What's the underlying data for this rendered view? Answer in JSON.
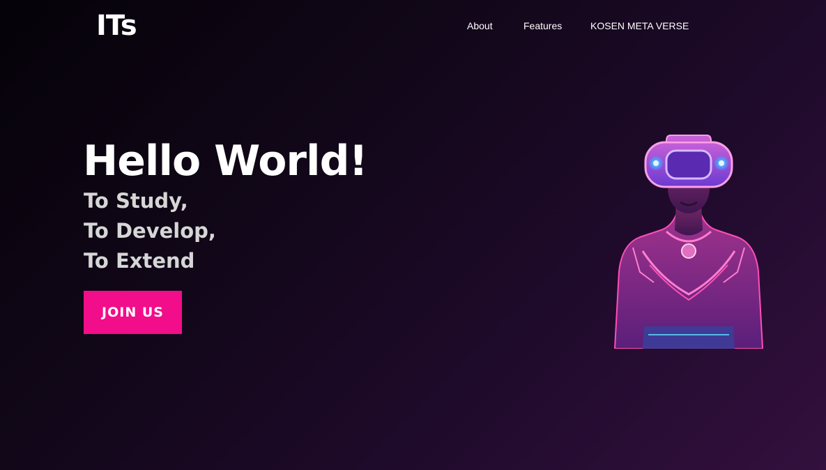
{
  "header": {
    "logo": "ITs",
    "nav": [
      {
        "label": "About"
      },
      {
        "label": "Features"
      },
      {
        "label": "KOSEN META VERSE"
      }
    ]
  },
  "hero": {
    "title": "Hello World!",
    "taglines": [
      "To Study,",
      "To Develop,",
      "To Extend"
    ],
    "cta_label": "JOIN US",
    "image": "vr-headset-woman-illustration"
  },
  "colors": {
    "background_start": "#050208",
    "background_end": "#33103e",
    "accent": "#f20d8a",
    "tagline": "#d6d6d6",
    "neon_pink": "#ff4fb8",
    "neon_blue": "#4aa0ff"
  }
}
